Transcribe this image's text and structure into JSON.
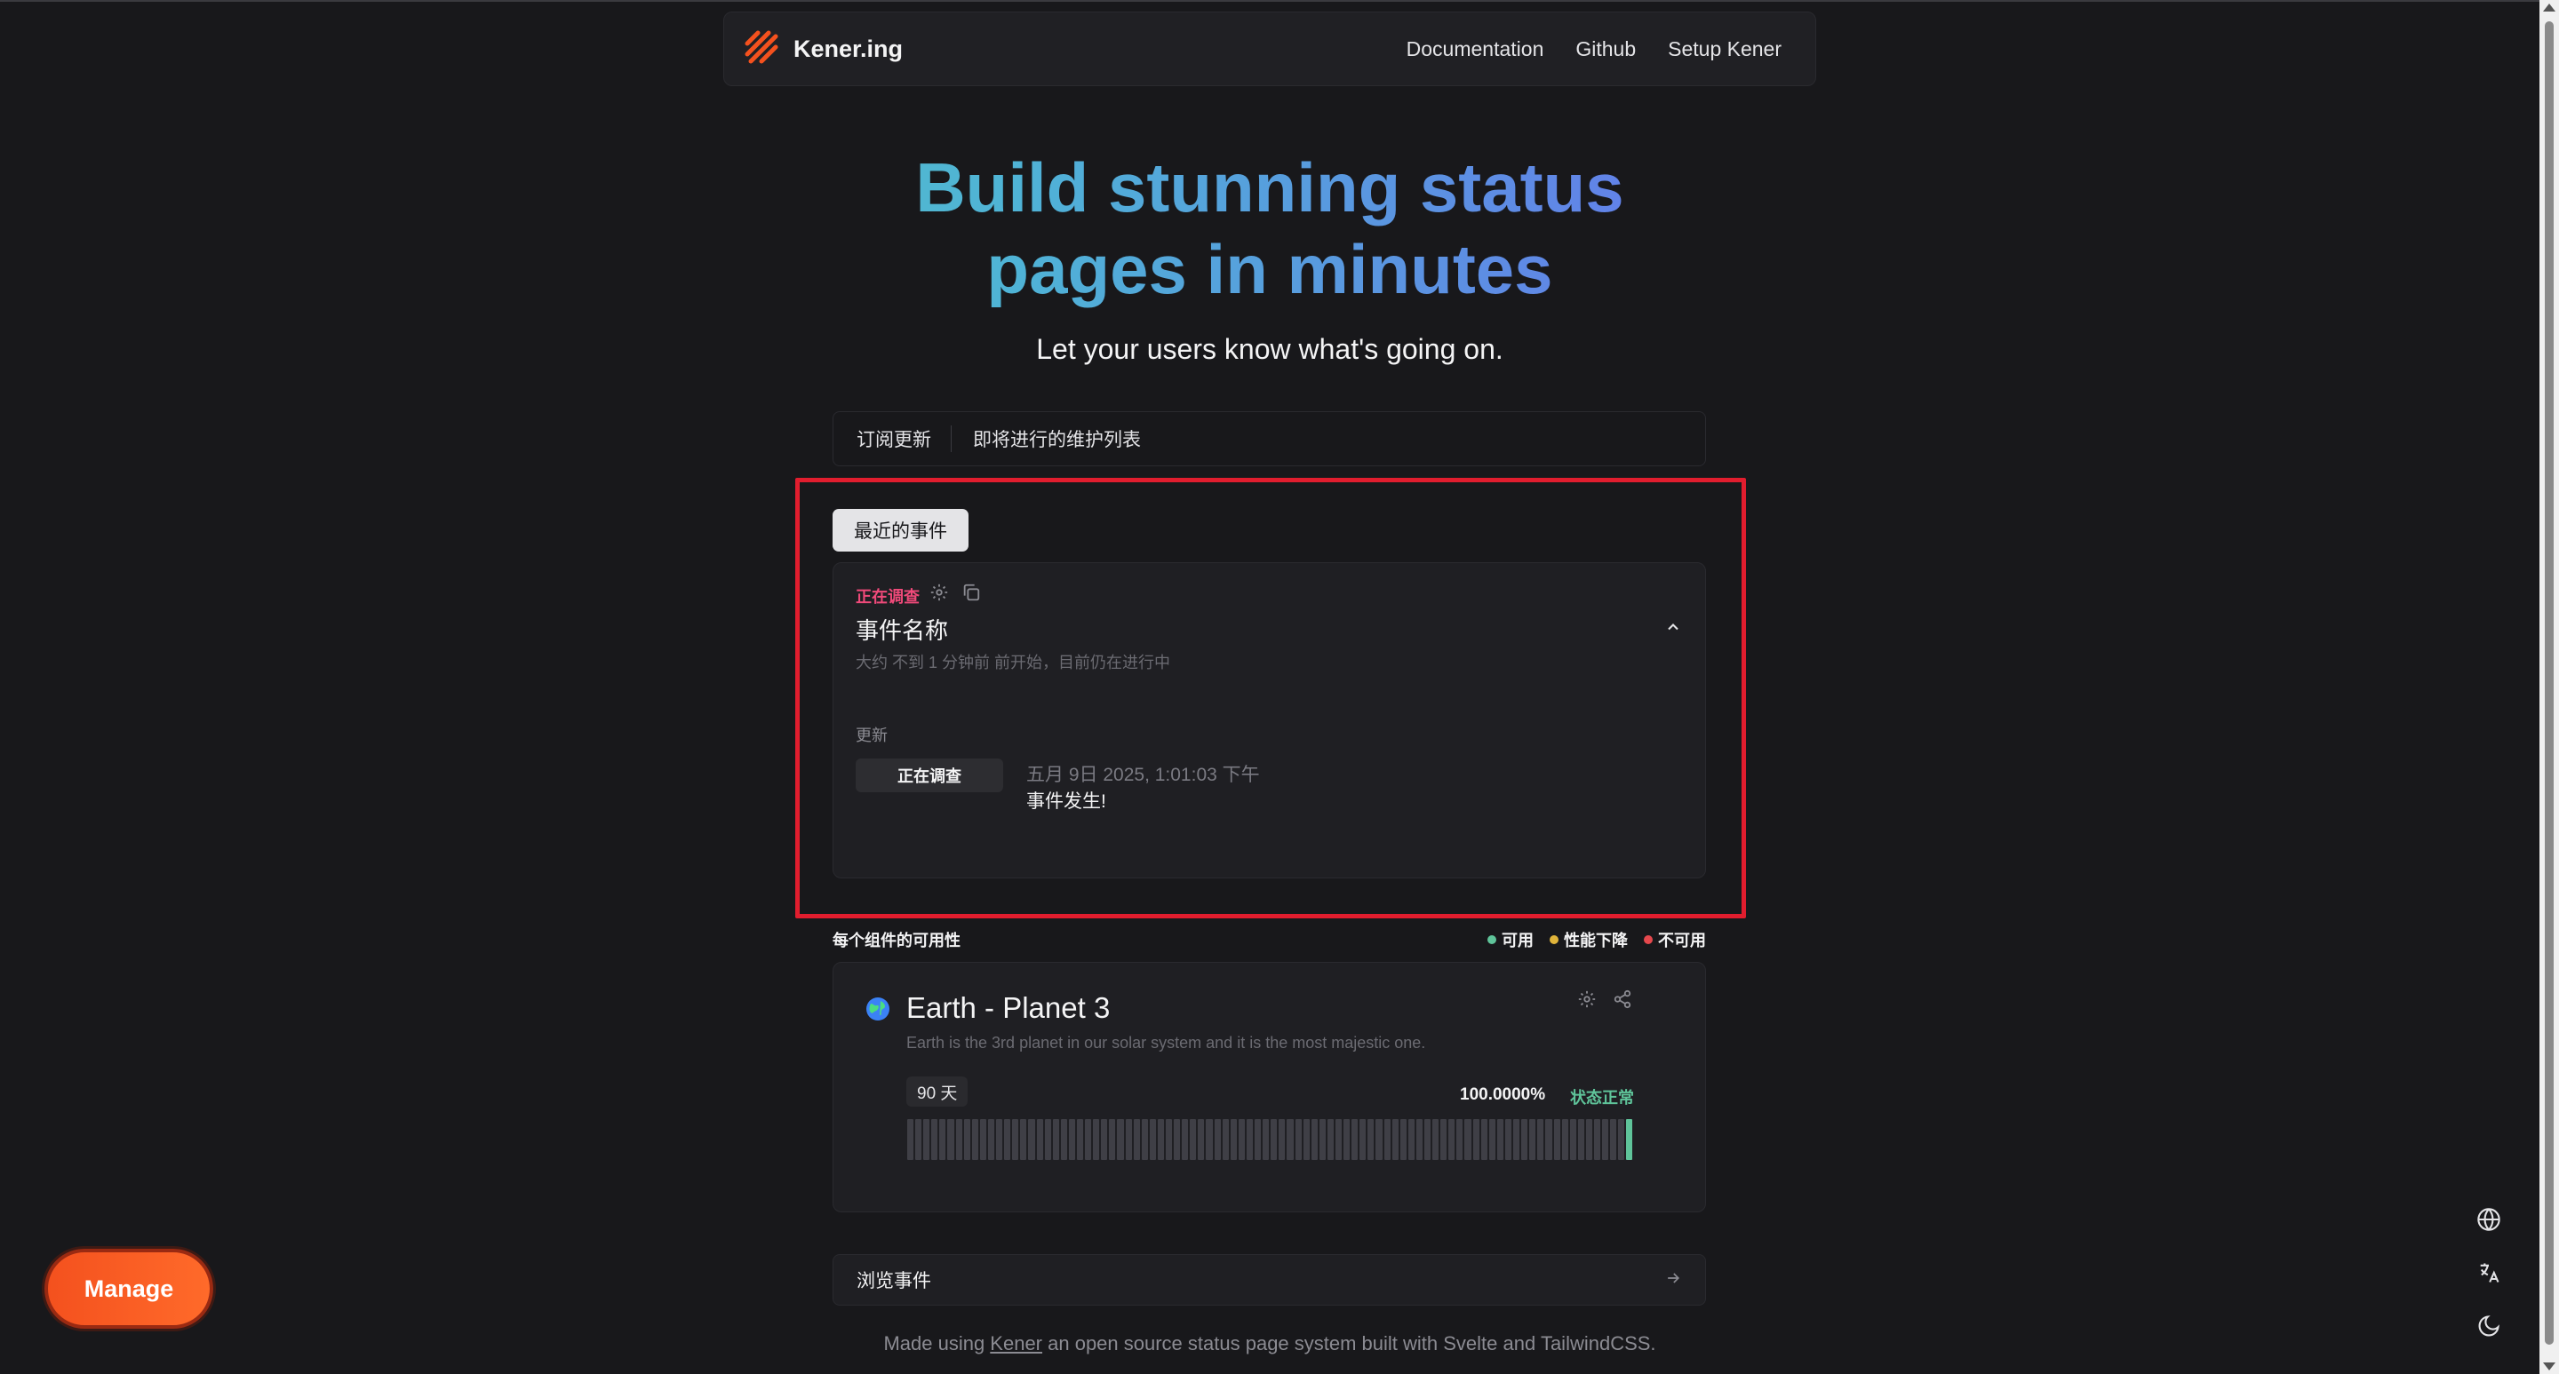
{
  "nav": {
    "brand": "Kener.ing",
    "links": [
      "Documentation",
      "Github",
      "Setup Kener"
    ]
  },
  "hero": {
    "title": "Build stunning status pages in minutes",
    "subtitle": "Let your users know what's going on."
  },
  "tabs": [
    "订阅更新",
    "即将进行的维护列表"
  ],
  "recent": {
    "chip": "最近的事件",
    "incident": {
      "status": "正在调查",
      "title": "事件名称",
      "started": "大约 不到 1 分钟前 前开始，目前仍在进行中",
      "updates_label": "更新",
      "update_badge": "正在调查",
      "update_time": "五月 9日 2025, 1:01:03 下午",
      "update_text": "事件发生!"
    }
  },
  "availability": {
    "title": "每个组件的可用性",
    "legend": [
      {
        "label": "可用",
        "color": "#5fc49a"
      },
      {
        "label": "性能下降",
        "color": "#e0b43a"
      },
      {
        "label": "不可用",
        "color": "#e5484d"
      }
    ]
  },
  "monitor": {
    "name": "Earth - Planet 3",
    "description": "Earth is the 3rd planet in our solar system and it is the most majestic one.",
    "range": "90 天",
    "uptime": "100.0000%",
    "state": "状态正常",
    "days_total": 90,
    "days_with_data": 1
  },
  "browse": "浏览事件",
  "footer": {
    "before": "Made using ",
    "link": "Kener",
    "after": " an open source status page system built with Svelte and TailwindCSS."
  },
  "manage": "Manage",
  "icons": {
    "brand": "kener-logo-icon",
    "settings": "gear-icon",
    "copy": "copy-icon",
    "chevron": "chevron-up-icon",
    "globe": "globe-icon",
    "share": "share-icon",
    "arrow": "arrow-right-icon",
    "language": "translate-icon",
    "theme": "moon-icon"
  },
  "colors": {
    "accent": "#f4511e",
    "status_investigating": "#f04a7a",
    "ok": "#5fc49a",
    "highlight": "#e11d2e"
  }
}
